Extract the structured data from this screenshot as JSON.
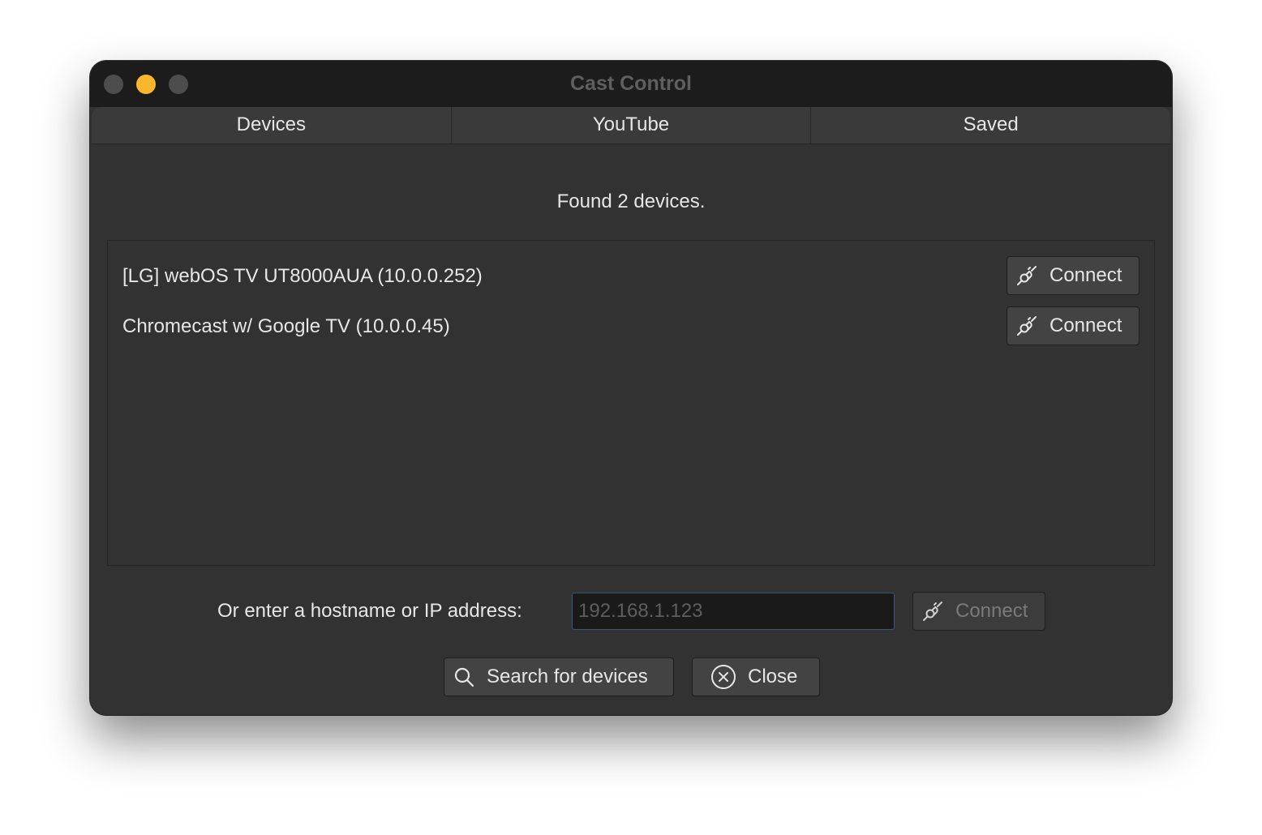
{
  "window": {
    "title": "Cast Control",
    "traffic_lights": [
      "close",
      "minimize",
      "maximize"
    ],
    "accent_color": "#fbb72c"
  },
  "tabs": [
    {
      "label": "Devices",
      "selected": true
    },
    {
      "label": "YouTube",
      "selected": false
    },
    {
      "label": "Saved",
      "selected": false
    }
  ],
  "devices_panel": {
    "status_text": "Found 2 devices.",
    "devices": [
      {
        "name": "[LG] webOS TV UT8000AUA (10.0.0.252)",
        "button_label": "Connect",
        "button_icon": "plug-icon"
      },
      {
        "name": "Chromecast w/ Google TV (10.0.0.45)",
        "button_label": "Connect",
        "button_icon": "plug-icon"
      }
    ],
    "manual": {
      "label": "Or enter a hostname or IP address:",
      "input_value": "",
      "input_placeholder": "192.168.1.123",
      "connect_label": "Connect",
      "connect_disabled": true
    },
    "actions": {
      "search_label": "Search for devices",
      "search_icon": "search-icon",
      "close_label": "Close",
      "close_icon": "close-circle-icon"
    }
  }
}
